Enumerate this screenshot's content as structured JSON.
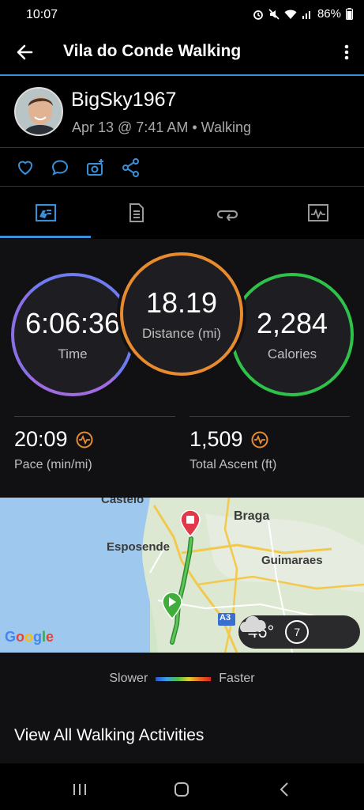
{
  "status_bar": {
    "time": "10:07",
    "battery": "86%"
  },
  "app_bar": {
    "title": "Vila do Conde Walking",
    "back_icon": "arrow-left-icon",
    "more_icon": "more-vertical-icon"
  },
  "profile": {
    "username": "BigSky1967",
    "subtitle": "Apr 13 @ 7:41 AM • Walking"
  },
  "actions": [
    {
      "name": "like",
      "icon": "heart-icon"
    },
    {
      "name": "comment",
      "icon": "comment-icon"
    },
    {
      "name": "add-photo",
      "icon": "camera-plus-icon"
    },
    {
      "name": "share",
      "icon": "share-icon"
    }
  ],
  "tabs": [
    {
      "name": "overview",
      "icon": "overview-icon",
      "active": true
    },
    {
      "name": "details",
      "icon": "document-icon",
      "active": false
    },
    {
      "name": "laps",
      "icon": "loop-icon",
      "active": false
    },
    {
      "name": "charts",
      "icon": "chart-icon",
      "active": false
    }
  ],
  "stats": {
    "time": {
      "value": "6:06:36",
      "label": "Time"
    },
    "distance": {
      "value": "18.19",
      "label": "Distance (mi)"
    },
    "calories": {
      "value": "2,284",
      "label": "Calories"
    },
    "pace": {
      "value": "20:09",
      "label": "Pace (min/mi)"
    },
    "ascent": {
      "value": "1,509",
      "label": "Total Ascent (ft)"
    }
  },
  "map": {
    "labels": {
      "castelo": "Castelo",
      "braga": "Braga",
      "esposende": "Esposende",
      "guimaraes": "Guimaraes",
      "highway": "A3"
    },
    "attribution": "Google",
    "weather": {
      "temp": "46°",
      "wind": "7"
    }
  },
  "legend": {
    "slower": "Slower",
    "faster": "Faster"
  },
  "view_all": "View All Walking Activities",
  "colors": {
    "accent": "#3a8fd6",
    "time_ring": "#6f7cf0",
    "distance_ring": "#e88b2f",
    "calories_ring": "#2ec24a",
    "background": "#000000",
    "panel": "#111113"
  }
}
